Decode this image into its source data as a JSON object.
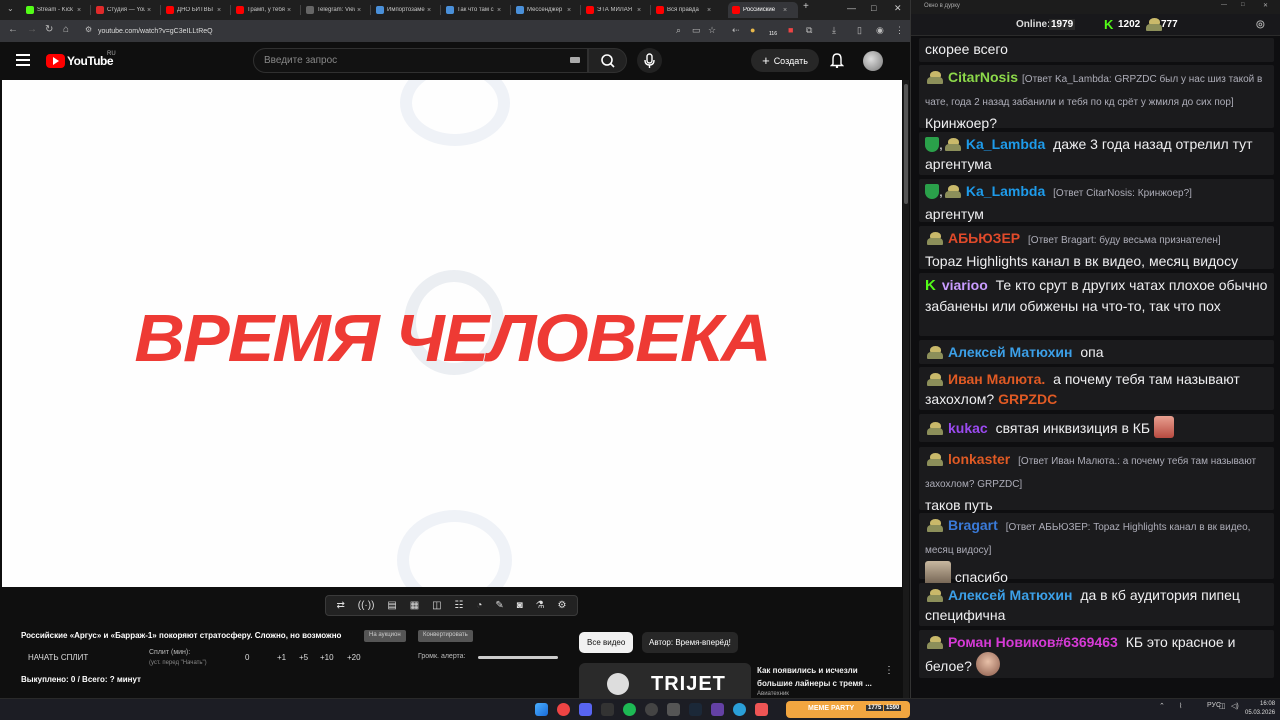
{
  "browser": {
    "tabs": [
      {
        "label": "Stream - Kick",
        "color": "#53fc18"
      },
      {
        "label": "Студия — YouTube",
        "color": "#ff0000"
      },
      {
        "label": "ДНО БИТВЫ",
        "color": "#ff0000"
      },
      {
        "label": "Трамп, у тебя",
        "color": "#ff0000"
      },
      {
        "label": "Telegram: View",
        "color": "#555555"
      },
      {
        "label": "Импортозамещ",
        "color": "#4a90d9"
      },
      {
        "label": "Так что там с",
        "color": "#4a90d9"
      },
      {
        "label": "Мессенджер",
        "color": "#4a90d9"
      },
      {
        "label": "ЭТА МИЛАЯ",
        "color": "#ff0000"
      },
      {
        "label": "Вся правда",
        "color": "#ff0000"
      },
      {
        "label": "Российские",
        "color": "#ff0000"
      }
    ],
    "url": "youtube.com/watch?v=gC3eILLtReQ",
    "download_badge": "116"
  },
  "youtube": {
    "logo_text": "YouTube",
    "region": "RU",
    "search_placeholder": "Введите запрос",
    "create_label": "Создать"
  },
  "video": {
    "overlay_title": "ВРЕМЯ ЧЕЛОВЕКА"
  },
  "below": {
    "title": "Российские «Аргус» и «Барраж-1» покоряют стратосферу. Сложно, но возможно",
    "chip_1": "На аукцион",
    "chip_2": "Конвертировать",
    "start_split": "НАЧАТЬ СПЛИТ",
    "split_label": "Сплит (мин):",
    "split_hint": "(уст. перед \"Начать\")",
    "split_values": [
      "0",
      "+1",
      "+5",
      "+10",
      "+20"
    ],
    "alert_volume": "Громк. алерта:",
    "bought": "Выкуплено: 0 / Всего: ? минут"
  },
  "recommendations": {
    "chip_all": "Все видео",
    "chip_author": "Автор: Время-вперёд!",
    "thumb_text": "TRIJET",
    "title": "Как появились и исчезли большие лайнеры с тремя ...",
    "channel": "Авиатехник"
  },
  "chat": {
    "window_title": "Окно в дурку",
    "online_label": "Online:",
    "online_value": "1979",
    "kick_count": "1202",
    "other_count": "777",
    "messages": [
      {
        "text": "скорее всего"
      },
      {
        "nick": "CitarNosis",
        "color": "#8cd84a",
        "reply": "[Ответ Ka_Lambda: GRPZDC был у нас шиз такой в чате, года 2 назад забанили и тебя по кд срёт у жмиля до сих пор]",
        "text": "Кринжоер?"
      },
      {
        "nick": "Ka_Lambda",
        "color": "#1e9bea",
        "text": "даже 3 года назад отрелил тут аргентума"
      },
      {
        "nick": "Ka_Lambda",
        "color": "#1e9bea",
        "reply": "[Ответ CitarNosis: Кринжоер?]",
        "text": "аргентум"
      },
      {
        "nick": "АБЬЮЗЕР",
        "color": "#e04a2a",
        "reply": "[Ответ Bragart: буду весьма признателен]",
        "text": "Topaz Highlights канал в вк видео, месяц видосу"
      },
      {
        "nick": "viarioo",
        "color": "#c99cff",
        "text": "Те кто срут в других чатах плохое обычно забанены или обижены на что-то, так что пох"
      },
      {
        "nick": "Алексей Матюхин",
        "color": "#3ca0e8",
        "text": "опа"
      },
      {
        "nick": "Иван Малюта.",
        "color": "#e05a24",
        "text": "а почему тебя там называют захохлом?",
        "tail": "GRPZDC",
        "tail_color": "#e05a24"
      },
      {
        "nick": "kukac",
        "color": "#9b4af0",
        "text": "святая инквизиция в КБ"
      },
      {
        "nick": "lonkaster",
        "color": "#e05a24",
        "reply": "[Ответ Иван Малюта.: а почему тебя там называют захохлом? GRPZDC]",
        "text": "таков путь"
      },
      {
        "nick": "Bragart",
        "color": "#3a7ad8",
        "reply": "[Ответ АБЬЮЗЕР: Topaz Highlights канал в вк видео, месяц видосу]",
        "text": "спасибо"
      },
      {
        "nick": "Алексей Матюхин",
        "color": "#3ca0e8",
        "text": "да в кб аудитория пипец специфична"
      },
      {
        "nick": "Роман Новиков#6369463",
        "color": "#d63ad6",
        "text": "КБ это красное и белое?"
      }
    ]
  },
  "taskbar": {
    "lang": "РУС",
    "time": "16:08",
    "date": "05.03.2026",
    "meme_party": "MEME PARTY",
    "counter_1": "1775",
    "counter_2": "1590"
  }
}
